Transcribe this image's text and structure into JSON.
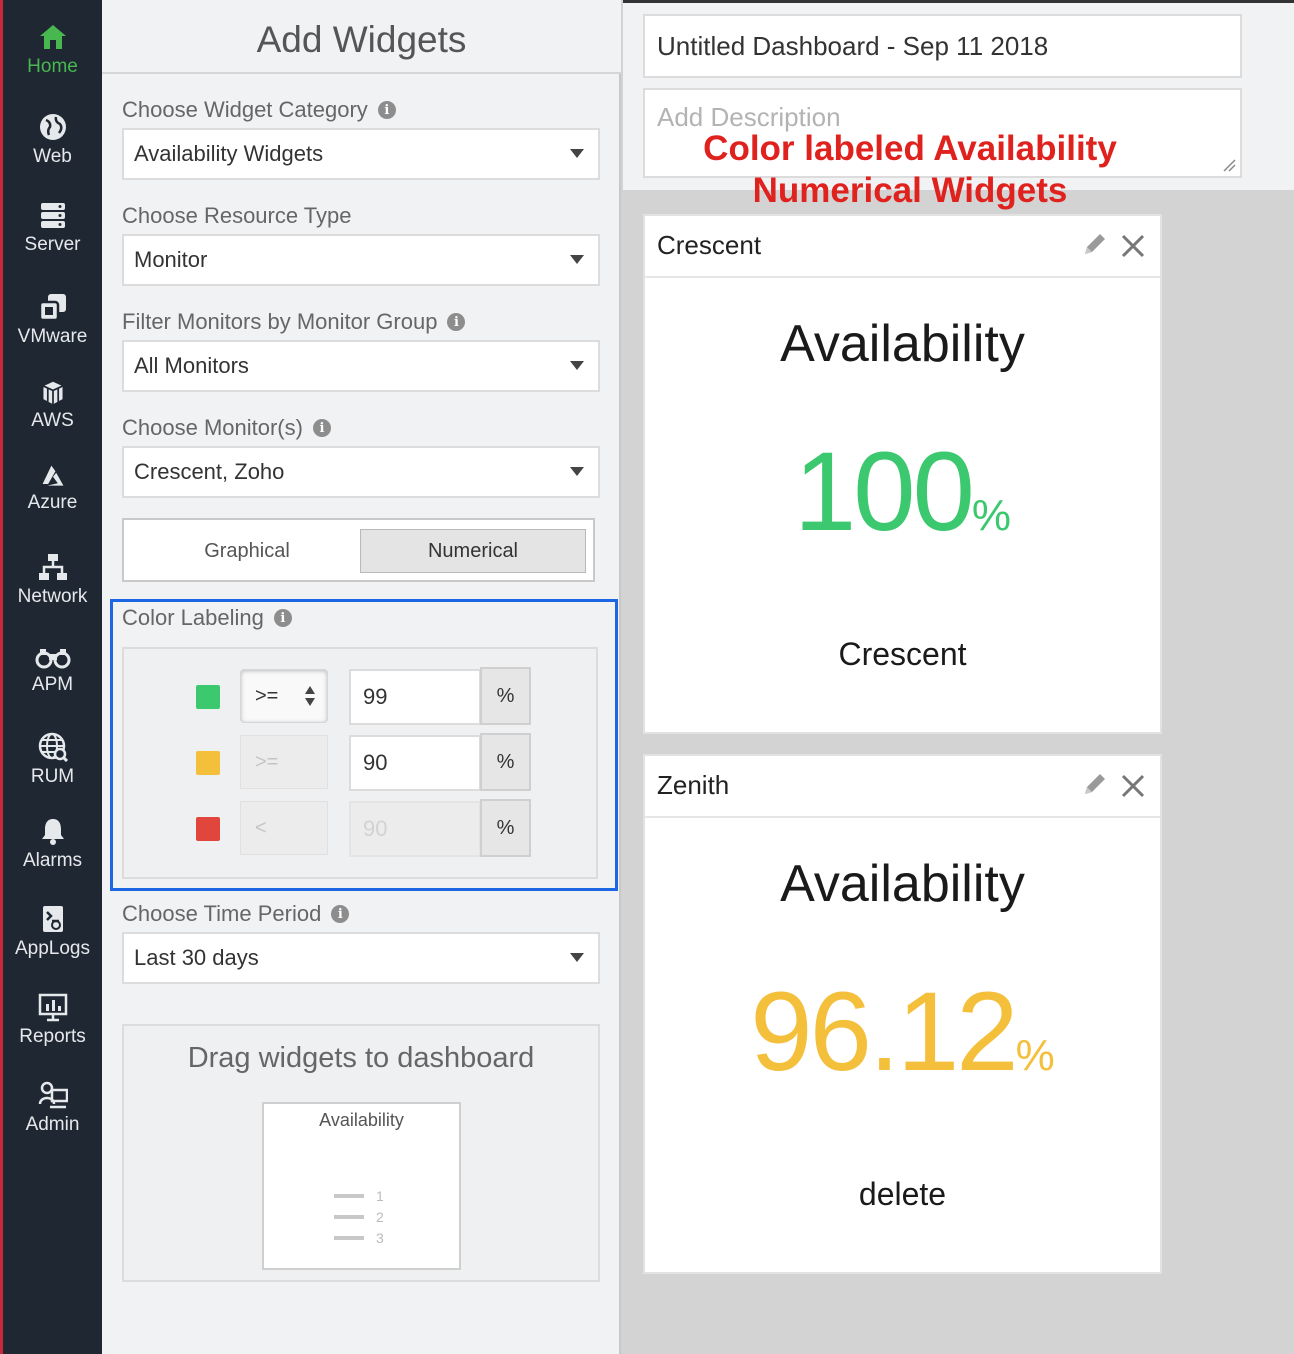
{
  "nav": [
    {
      "label": "Home",
      "icon": "home-icon",
      "active": true
    },
    {
      "label": "Web",
      "icon": "globe-icon"
    },
    {
      "label": "Server",
      "icon": "server-icon"
    },
    {
      "label": "VMware",
      "icon": "vmware-icon"
    },
    {
      "label": "AWS",
      "icon": "aws-icon"
    },
    {
      "label": "Azure",
      "icon": "azure-icon"
    },
    {
      "label": "Network",
      "icon": "network-icon"
    },
    {
      "label": "APM",
      "icon": "binoculars-icon"
    },
    {
      "label": "RUM",
      "icon": "rum-globe-icon"
    },
    {
      "label": "Alarms",
      "icon": "bell-icon"
    },
    {
      "label": "AppLogs",
      "icon": "applogs-icon"
    },
    {
      "label": "Reports",
      "icon": "reports-icon"
    },
    {
      "label": "Admin",
      "icon": "admin-icon"
    }
  ],
  "panel": {
    "title": "Add Widgets",
    "category": {
      "label": "Choose Widget Category",
      "value": "Availability Widgets"
    },
    "resource": {
      "label": "Choose Resource Type",
      "value": "Monitor"
    },
    "group": {
      "label": "Filter Monitors by Monitor Group",
      "value": "All Monitors"
    },
    "monitors": {
      "label": "Choose Monitor(s)",
      "value": "Crescent, Zoho"
    },
    "view_toggle": {
      "graphical": "Graphical",
      "numerical": "Numerical",
      "selected": "Numerical"
    },
    "color_labeling": {
      "label": "Color Labeling",
      "rows": [
        {
          "color": "#3cc86e",
          "operator": ">=",
          "value": "99",
          "unit": "%"
        },
        {
          "color": "#f4c03c",
          "operator": ">=",
          "value": "90",
          "unit": "%"
        },
        {
          "color": "#e2453c",
          "operator": "<",
          "value": "90",
          "unit": "%"
        }
      ]
    },
    "time_period": {
      "label": "Choose Time Period",
      "value": "Last 30 days"
    },
    "drag": {
      "title": "Drag widgets to dashboard",
      "widget_title": "Availability",
      "list_numbers": [
        "1",
        "2",
        "3"
      ]
    }
  },
  "dashboard": {
    "name": "Untitled Dashboard - Sep 11 2018",
    "description_placeholder": "Add Description",
    "annotation": [
      "Color labeled Availability",
      "Numerical Widgets"
    ],
    "cards": [
      {
        "name": "Crescent",
        "metric": "Availability",
        "value": "100",
        "unit": "%",
        "value_color": "#3cc86e",
        "subtitle": "Crescent"
      },
      {
        "name": "Zenith",
        "metric": "Availability",
        "value": "96.12",
        "unit": "%",
        "value_color": "#f4c03c",
        "subtitle": "delete"
      }
    ]
  },
  "colors": {
    "nav_bg": "#1f2832",
    "nav_active": "#48b74f",
    "highlight_border": "#1c66e3",
    "annotation": "#e0221e"
  }
}
